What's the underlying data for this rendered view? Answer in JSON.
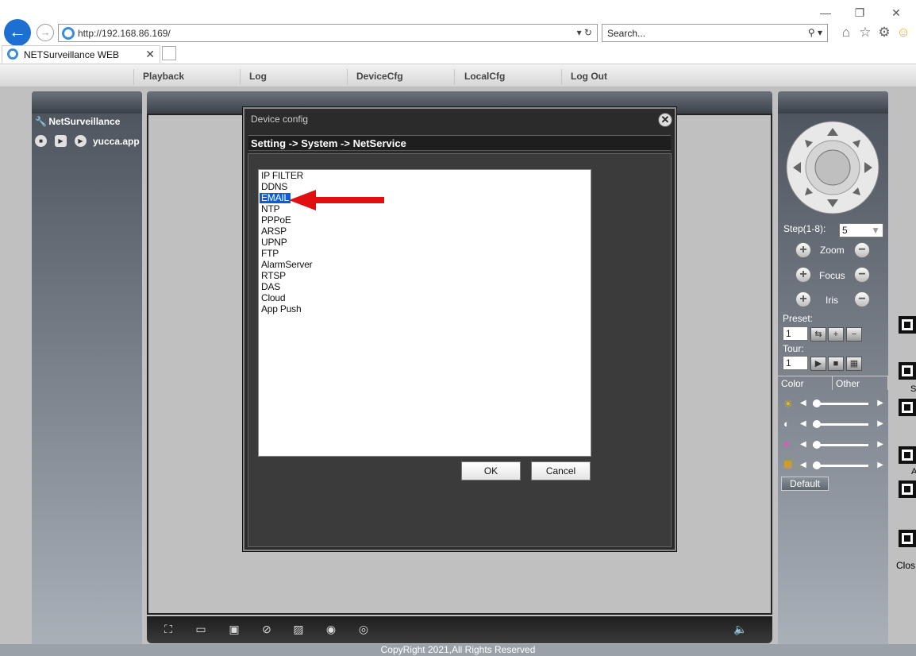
{
  "browser": {
    "url": "http://192.168.86.169/",
    "search_placeholder": "Search...",
    "tab_title": "NETSurveillance WEB"
  },
  "menu": {
    "items": [
      "Playback",
      "Log",
      "DeviceCfg",
      "LocalCfg",
      "Log Out"
    ]
  },
  "left_panel": {
    "root_label": "NetSurveillance",
    "device_name": "yucca.app"
  },
  "dialog": {
    "title": "Device config",
    "breadcrumb": "Setting -> System -> NetService",
    "items": [
      "IP FILTER",
      "DDNS",
      "EMAIL",
      "NTP",
      "PPPoE",
      "ARSP",
      "UPNP",
      "FTP",
      "AlarmServer",
      "RTSP",
      "DAS",
      "Cloud",
      "App Push"
    ],
    "selected_item": "EMAIL",
    "ok_label": "OK",
    "cancel_label": "Cancel"
  },
  "ptz": {
    "step_label": "Step(1-8):",
    "step_value": "5",
    "zoom_label": "Zoom",
    "focus_label": "Focus",
    "iris_label": "Iris",
    "preset_label": "Preset:",
    "preset_value": "1",
    "tour_label": "Tour:",
    "tour_value": "1",
    "tabs": [
      "Color",
      "Other"
    ],
    "default_label": "Default"
  },
  "side_fragments": [
    "S",
    "A",
    "Clos"
  ],
  "footer": "CopyRight 2021,All Rights Reserved",
  "colors": {
    "selection": "#0a5dd6",
    "annotation_arrow": "#e11010",
    "panel_dark": "#3a4048"
  }
}
